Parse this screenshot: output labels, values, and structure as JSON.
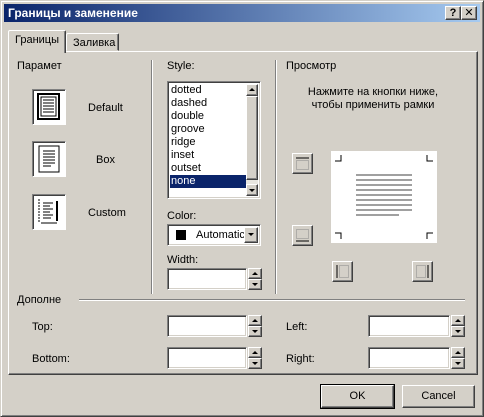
{
  "dialog": {
    "title": "Границы и заменение",
    "help_glyph": "?",
    "close_glyph": "✕"
  },
  "tabs": [
    {
      "label": "Границы",
      "active": true
    },
    {
      "label": "Заливка",
      "active": false
    }
  ],
  "presets": {
    "group_label": "Парамет",
    "items": [
      {
        "label": "Default",
        "icon": "border-default-icon"
      },
      {
        "label": "Box",
        "icon": "border-box-icon"
      },
      {
        "label": "Custom",
        "icon": "border-custom-icon"
      }
    ]
  },
  "style": {
    "label": "Style:",
    "options": [
      "dotted",
      "dashed",
      "double",
      "groove",
      "ridge",
      "inset",
      "outset",
      "none"
    ],
    "selected": "none",
    "color_label": "Color:",
    "color_value": "Automatic",
    "width_label": "Width:",
    "width_value": ""
  },
  "preview": {
    "label": "Просмотр",
    "hint_line1": "Нажмите на кнопки ниже,",
    "hint_line2": "чтобы применить рамки"
  },
  "margins": {
    "group_label": "Дополне",
    "top_label": "Top:",
    "top_value": "",
    "bottom_label": "Bottom:",
    "bottom_value": "",
    "left_label": "Left:",
    "left_value": "",
    "right_label": "Right:",
    "right_value": ""
  },
  "buttons": {
    "ok": "OK",
    "cancel": "Cancel"
  },
  "colors": {
    "titlebar_start": "#0a246a",
    "titlebar_end": "#a6caf0",
    "face": "#d4d0c8",
    "selection": "#0a246a"
  }
}
